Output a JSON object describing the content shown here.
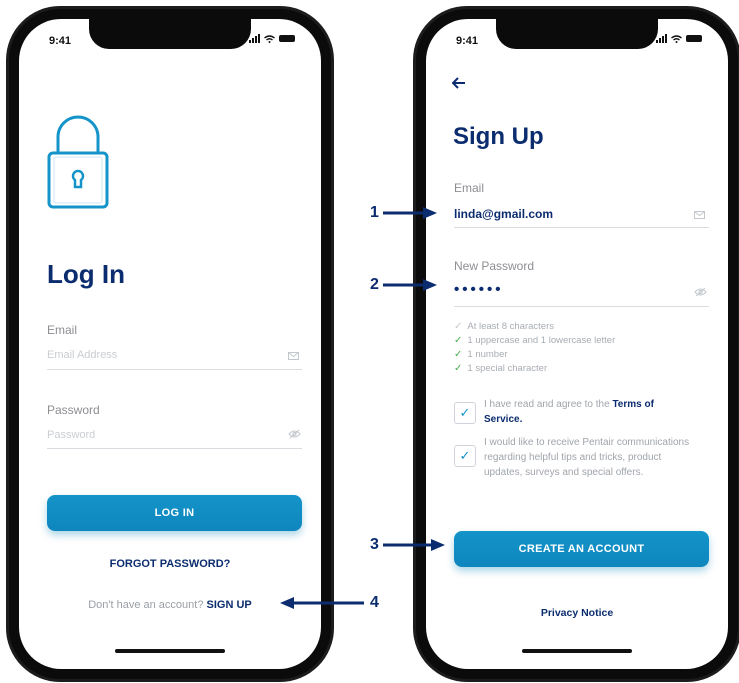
{
  "status": {
    "time": "9:41"
  },
  "login": {
    "title": "Log In",
    "email_label": "Email",
    "email_placeholder": "Email Address",
    "password_label": "Password",
    "password_placeholder": "Password",
    "login_button": "LOG IN",
    "forgot_password": "FORGOT PASSWORD?",
    "no_account_text": "Don't have an account?",
    "sign_up_link": "SIGN UP"
  },
  "signup": {
    "title": "Sign Up",
    "email_label": "Email",
    "email_value": "linda@gmail.com",
    "password_label": "New Password",
    "password_value": "••••••",
    "requirements": [
      {
        "text": "At least 8 characters",
        "met": false
      },
      {
        "text": "1 uppercase and 1 lowercase letter",
        "met": true
      },
      {
        "text": "1 number",
        "met": true
      },
      {
        "text": "1 special character",
        "met": true
      }
    ],
    "terms_prefix": "I have read and agree to the",
    "terms_link": "Terms of Service.",
    "marketing_text": "I would like to receive Pentair communications regarding helpful tips and tricks, product updates, surveys and special offers.",
    "create_button": "CREATE AN ACCOUNT",
    "privacy_notice": "Privacy Notice"
  },
  "callouts": [
    "1",
    "2",
    "3",
    "4"
  ],
  "icons": [
    "lock-icon",
    "mail-icon",
    "eye-off-icon",
    "back-arrow-icon",
    "checkmark-icon",
    "signal-icon",
    "wifi-icon",
    "battery-icon"
  ],
  "colors": {
    "navy": "#0b2c6e",
    "accent": "#1494c9",
    "check_green": "#4caf50"
  }
}
